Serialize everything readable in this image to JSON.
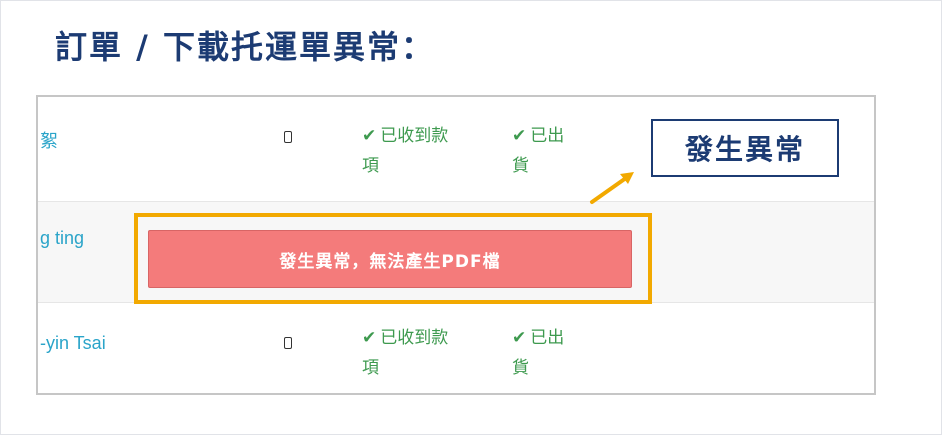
{
  "title": "訂單 / 下載托運單異常：",
  "callout": "發生異常",
  "error_button": "發生異常，無法產生PDF檔",
  "rows": [
    {
      "name": "絮",
      "device": "phone-icon",
      "payment": [
        "已收到款",
        "項"
      ],
      "shipping": [
        "已出",
        "貨"
      ]
    },
    {
      "name": "g ting"
    },
    {
      "name": "-yin Tsai",
      "device": "phone-icon",
      "payment": [
        "已收到款",
        "項"
      ],
      "shipping": [
        "已出",
        "貨"
      ]
    }
  ],
  "colors": {
    "title": "#1c3b73",
    "highlight": "#f2a900",
    "error": "#f47b7b",
    "status": "#3e9a4f",
    "link": "#2aa4c9"
  }
}
